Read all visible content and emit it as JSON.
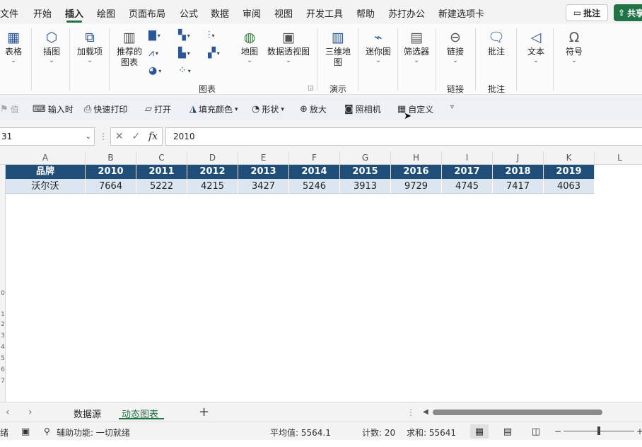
{
  "tabs": [
    "文件",
    "开始",
    "插入",
    "绘图",
    "页面布局",
    "公式",
    "数据",
    "审阅",
    "视图",
    "开发工具",
    "帮助",
    "苏打办公",
    "新建选项卡"
  ],
  "active_tab": "插入",
  "buttons": {
    "comment": "批注",
    "share": "共享"
  },
  "ribbon": {
    "table": "表格",
    "illustrations": "插图",
    "addins": "加载项",
    "recommended_charts_line1": "推荐的",
    "recommended_charts_line2": "图表",
    "map": "地图",
    "pivot_chart": "数据透视图",
    "map3d_line1": "三维地",
    "map3d_line2": "图",
    "sparklines": "迷你图",
    "filters": "筛选器",
    "link": "链接",
    "comment": "批注",
    "text": "文本",
    "symbols": "符号",
    "groups": {
      "charts": "图表",
      "tours": "演示",
      "links": "链接",
      "comments": "批注"
    }
  },
  "quick_access": {
    "value_partial": "值",
    "input_time": "输入时",
    "quick_print": "快速打印",
    "open": "打开",
    "fill_color": "填充颜色",
    "shapes": "形状",
    "zoom_in": "放大",
    "camera": "照相机",
    "custom": "自定义"
  },
  "formula_bar": {
    "name_box": "31",
    "formula_value": "2010",
    "fx_label": "fx"
  },
  "columns": [
    "A",
    "B",
    "C",
    "D",
    "E",
    "F",
    "G",
    "H",
    "I",
    "J",
    "K",
    "L"
  ],
  "table": {
    "header": [
      "品牌",
      "2010",
      "2011",
      "2012",
      "2013",
      "2014",
      "2015",
      "2016",
      "2017",
      "2018",
      "2019"
    ],
    "rows": [
      [
        "沃尔沃",
        "7664",
        "5222",
        "4215",
        "3427",
        "5246",
        "3913",
        "9729",
        "4745",
        "7417",
        "4063"
      ]
    ]
  },
  "sheet_tabs": [
    "数据源",
    "动态图表"
  ],
  "active_sheet": "动态图表",
  "status": {
    "ready_partial": "绪",
    "accessibility": "辅助功能: 一切就绪",
    "average": "平均值: 5564.1",
    "count": "计数: 20",
    "sum": "求和: 55641",
    "zoom_minus": "−",
    "zoom_plus": "+"
  },
  "colors": {
    "accent": "#217346",
    "table_header_bg": "#1f4e79",
    "table_row_bg": "#dce6f1"
  }
}
